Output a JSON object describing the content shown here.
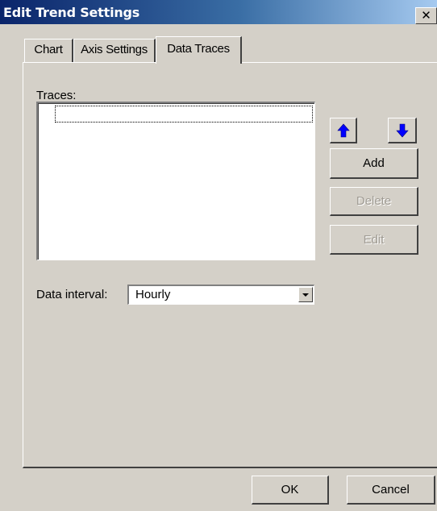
{
  "window": {
    "title": "Edit Trend Settings",
    "close_glyph": "✕"
  },
  "tabs": [
    {
      "label": "Chart",
      "selected": false
    },
    {
      "label": "Axis Settings",
      "selected": false
    },
    {
      "label": "Data Traces",
      "selected": true
    }
  ],
  "traces": {
    "label": "Traces:",
    "items": []
  },
  "buttons": {
    "move_up_icon": "arrow-up-icon",
    "move_down_icon": "arrow-down-icon",
    "add": "Add",
    "delete": "Delete",
    "edit": "Edit",
    "ok": "OK",
    "cancel": "Cancel"
  },
  "data_interval": {
    "label": "Data interval:",
    "value": "Hourly"
  },
  "colors": {
    "arrow_blue": "#0000ff",
    "face": "#d4d0c8"
  }
}
